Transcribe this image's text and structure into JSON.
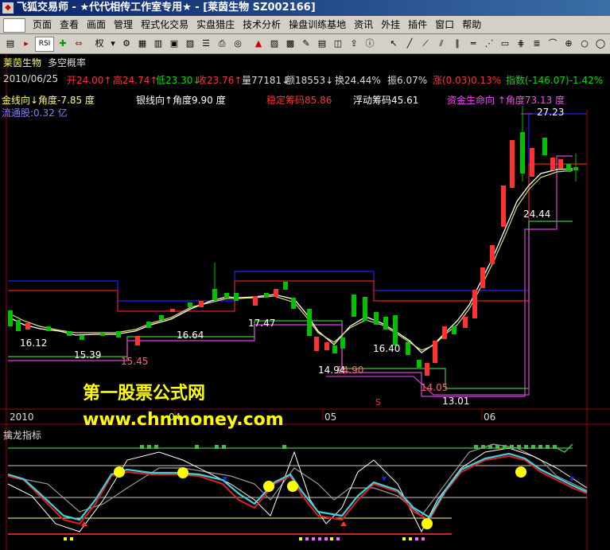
{
  "window": {
    "title": "飞狐交易师 - ★代代相传工作室专用★ - [莱茵生物 SZ002166]"
  },
  "menu": [
    "页面",
    "查看",
    "画面",
    "管理",
    "程式化交易",
    "实盘猎庄",
    "技术分析",
    "操盘训练基地",
    "资讯",
    "外挂",
    "插件",
    "窗口",
    "帮助"
  ],
  "toolbar": {
    "rsi_label": "RSI",
    "weight_label": "权"
  },
  "stock": {
    "name": "莱茵生物",
    "indicator_name": "多空概率",
    "date": "2010/06/25",
    "open": "开24.00↑",
    "high": "高24.74↑",
    "low": "低23.30↓",
    "close": "收23.76↑",
    "volume": "量77181↓",
    "amount": "额18553↓",
    "turnover": "换24.44%",
    "amplitude": "振6.07%",
    "change": "涨(0.03)0.13%",
    "index": "指数(-146.07)-1.42%"
  },
  "overlay": {
    "gold_line": "金线向↓角度-7.85 度",
    "silver_line": "银线向↑角度9.90 度",
    "stable_chips": "稳定筹码85.86",
    "float_chips": "浮动筹码45.61",
    "capital_line": "资金生命向 ↑角度73.13 度",
    "float_shares": "流通股:0.32 亿"
  },
  "price_labels": [
    "27.23",
    "24.44",
    "16.12",
    "15.39",
    "15.45",
    "16.64",
    "17.47",
    "14.94",
    "14.90",
    "16.40",
    "14.05",
    "13.01"
  ],
  "axis": {
    "year": "2010",
    "month_04": "04",
    "month_05": "05",
    "month_06": "06",
    "marker": "S"
  },
  "watermark": {
    "line1": "第一股票公式网",
    "line2": "www.chnmoney.com"
  },
  "sub_indicator": {
    "name": "擒龙指标"
  },
  "colors": {
    "up": "#ff3232",
    "down": "#00c000",
    "blue_line": "#2020ff",
    "red_line": "#e02020",
    "green_line": "#40c040",
    "purple_line": "#e040e0",
    "cyan_line": "#40d0e0"
  }
}
